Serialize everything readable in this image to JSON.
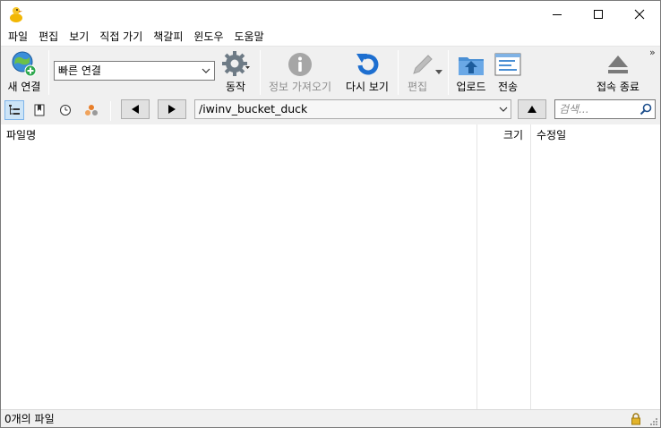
{
  "menu": [
    "파일",
    "편집",
    "보기",
    "직접 가기",
    "책갈피",
    "윈도우",
    "도움말"
  ],
  "toolbar": {
    "new_connection": "새 연결",
    "quick_connect": "빠른 연결",
    "action": "동작",
    "get_info": "정보 가져오기",
    "refresh": "다시 보기",
    "edit": "편집",
    "upload": "업로드",
    "transfers": "전송",
    "disconnect": "접속 종료"
  },
  "pathbar": {
    "path": "/iwinv_bucket_duck",
    "search_placeholder": "검색..."
  },
  "columns": {
    "filename": "파일명",
    "size": "크기",
    "modified": "수정일"
  },
  "status": {
    "text": "0개의 파일"
  },
  "colors": {
    "toolbar_bg": "#f0f0f0",
    "accent_blue": "#1e6fd0",
    "disabled_gray": "#a6a6a6"
  }
}
